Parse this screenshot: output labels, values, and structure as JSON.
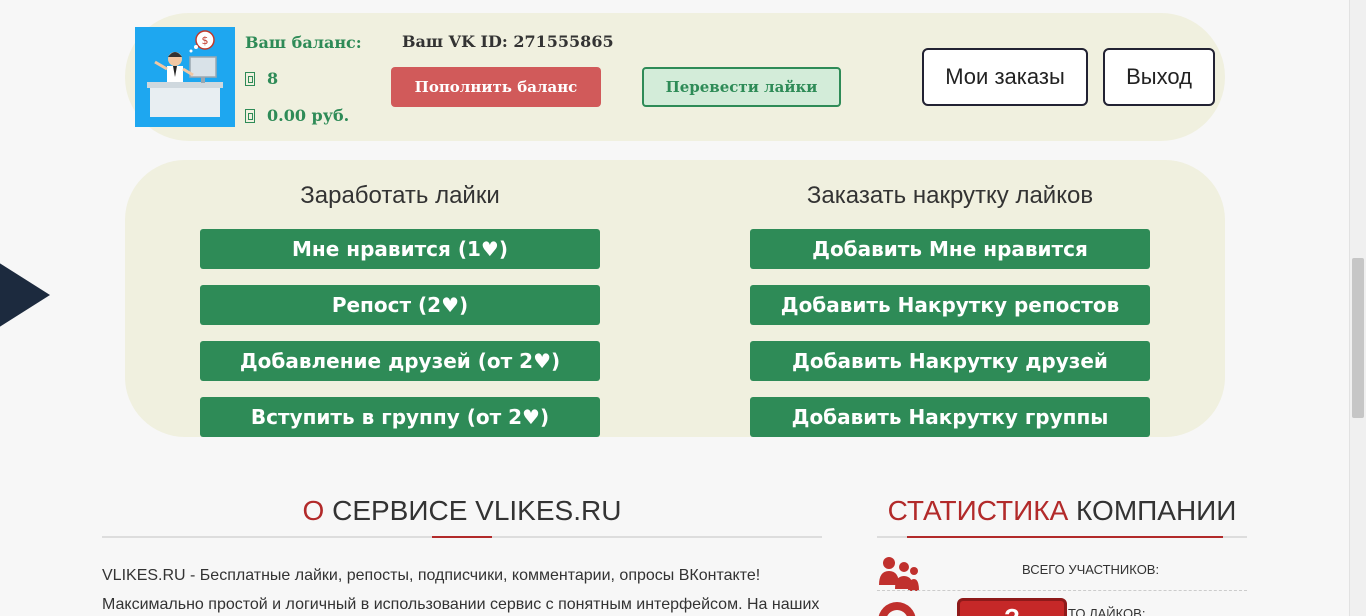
{
  "balance": {
    "label": "Ваш баланс:",
    "likes": "8",
    "money": "0.00 руб."
  },
  "vk_id": "Ваш VK ID: 271555865",
  "buttons": {
    "topup": "Пополнить баланс",
    "transfer": "Перевести лайки",
    "orders": "Мои заказы",
    "exit": "Выход"
  },
  "earn": {
    "title": "Заработать лайки",
    "items": [
      "Мне нравится (1♥)",
      "Репост (2♥)",
      "Добавление друзей (от 2♥)",
      "Вступить в группу (от 2♥)"
    ]
  },
  "order": {
    "title": "Заказать накрутку лайков",
    "items": [
      "Добавить Мне нравится",
      "Добавить Накрутку репостов",
      "Добавить Накрутку друзей",
      "Добавить Накрутку группы"
    ]
  },
  "about": {
    "title_accent": "О",
    "title_rest": " СЕРВИСЕ VLIKES.RU",
    "line1": "VLIKES.RU - Бесплатные лайки, репосты, подписчики, комментарии, опросы ВКонтакте!",
    "line2": "Максимально простой и логичный в использовании сервис с понятным интерфейсом. На наших"
  },
  "stats": {
    "title_accent": "СТАТИСТИКА",
    "title_rest": " КОМПАНИИ",
    "members_label": "ВСЕГО УЧАСТНИКОВ:",
    "likes_label": "ТО ЛАЙКОВ:",
    "badge": "?"
  },
  "colors": {
    "green": "#2e8b57",
    "red": "#d15a5a",
    "panel": "#f0f0df",
    "accent_red": "#b22a2a"
  }
}
